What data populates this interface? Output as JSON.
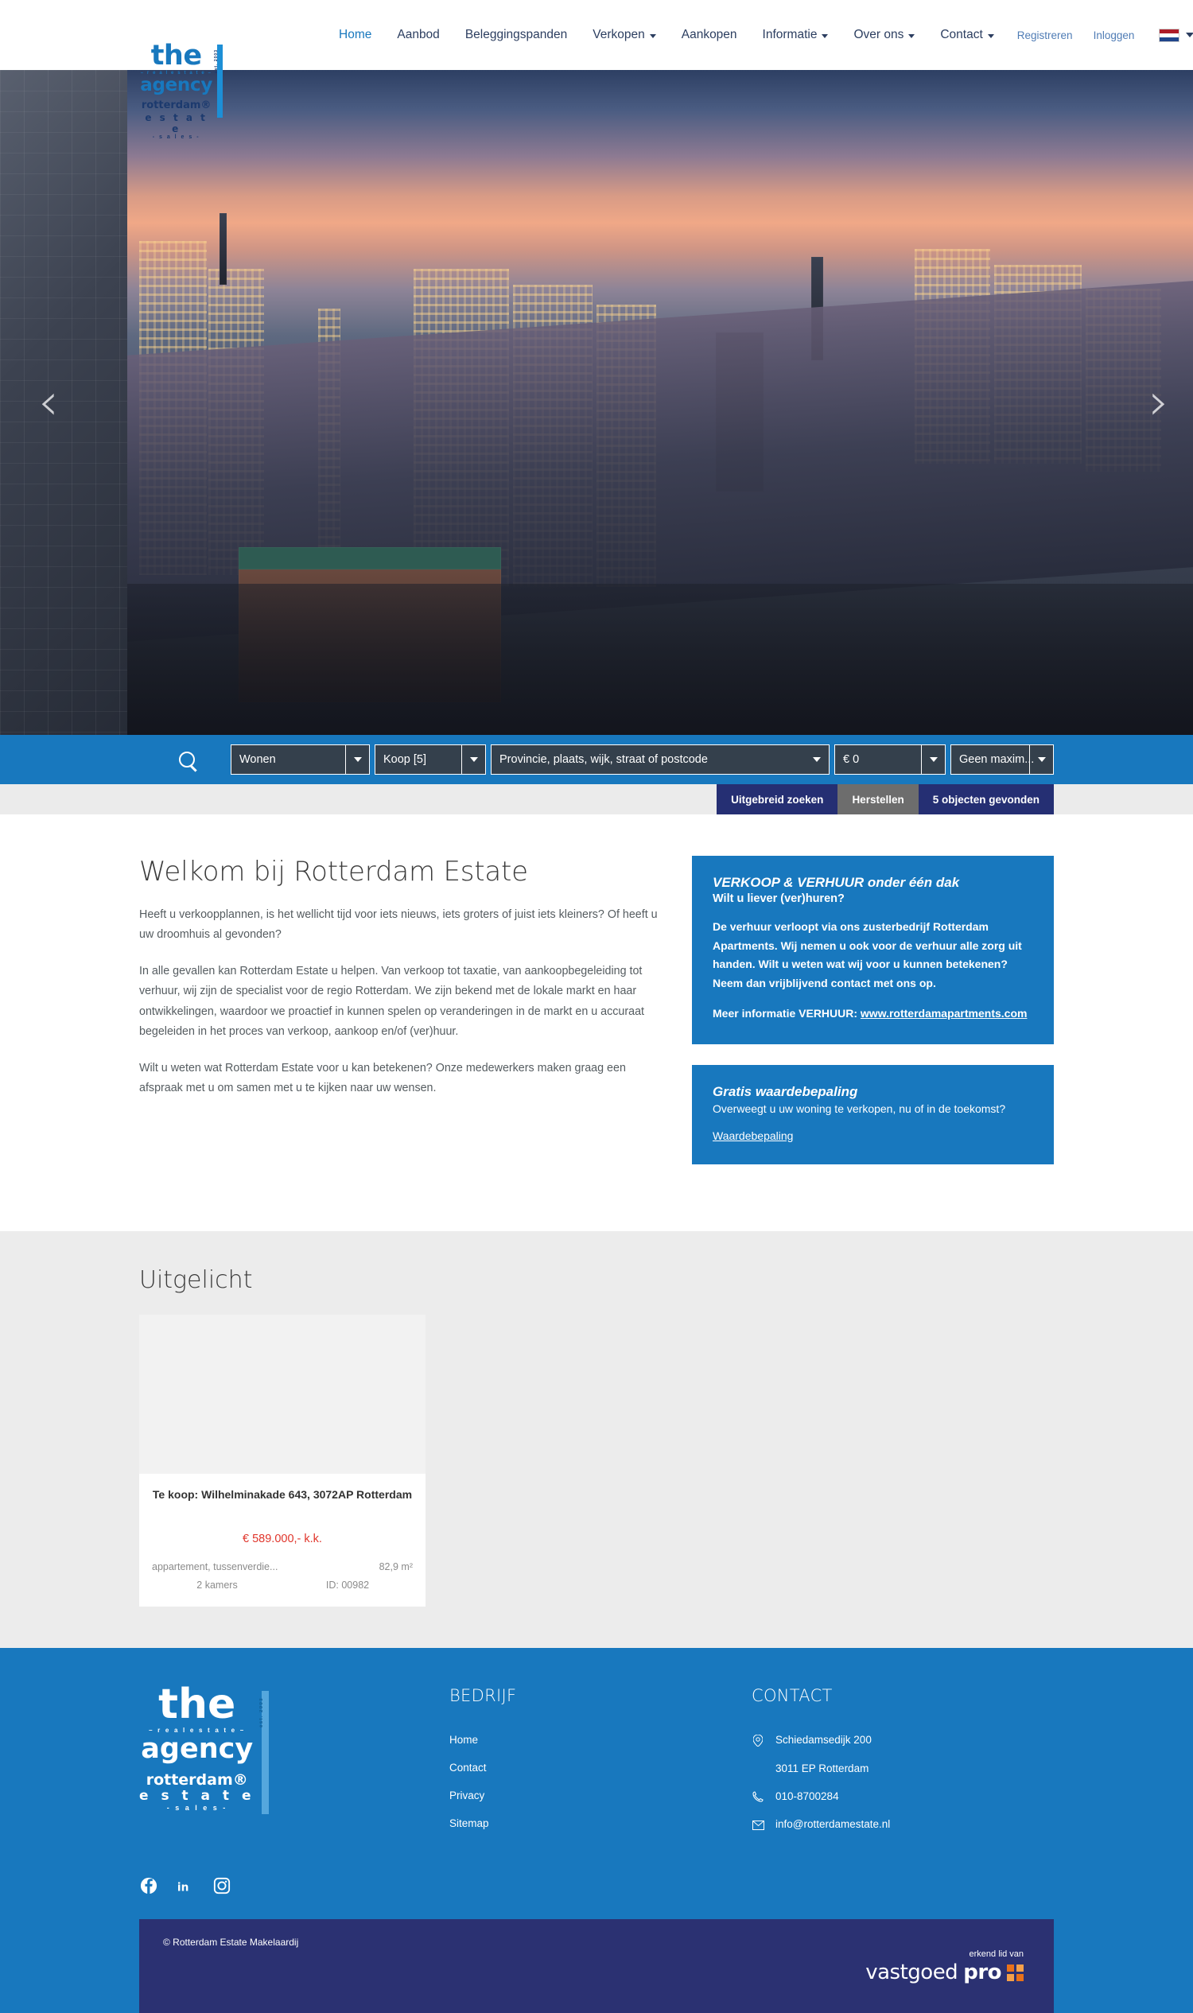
{
  "header": {
    "logo": {
      "the": "the",
      "tagline": "– r e a l   e s t a t e –",
      "agency": "agency",
      "rotterdam": "rotterdam®",
      "estate": "e s t a t e",
      "sales": "- s a l e s -",
      "est": "est. 2003"
    },
    "nav": [
      {
        "label": "Home",
        "active": true,
        "dropdown": false
      },
      {
        "label": "Aanbod",
        "active": false,
        "dropdown": false
      },
      {
        "label": "Beleggingspanden",
        "active": false,
        "dropdown": false
      },
      {
        "label": "Verkopen",
        "active": false,
        "dropdown": true
      },
      {
        "label": "Aankopen",
        "active": false,
        "dropdown": false
      },
      {
        "label": "Informatie",
        "active": false,
        "dropdown": true
      },
      {
        "label": "Over ons",
        "active": false,
        "dropdown": true
      },
      {
        "label": "Contact",
        "active": false,
        "dropdown": true
      }
    ],
    "auth": [
      {
        "label": "Registreren"
      },
      {
        "label": "Inloggen"
      }
    ],
    "language": "Nederlands"
  },
  "hero": {
    "prev_label": "‹",
    "next_label": "›",
    "alt": "Rotterdam skyline bij zonsondergang"
  },
  "search": {
    "icon": "search-icon",
    "type": {
      "value": "Wonen"
    },
    "offer": {
      "value": "Koop [5]"
    },
    "location": {
      "placeholder": "Provincie, plaats, wijk, straat of postcode",
      "value": ""
    },
    "price_min": {
      "value": "€ 0"
    },
    "price_max": {
      "value": "Geen maxim..."
    },
    "buttons": {
      "advanced": "Uitgebreid zoeken",
      "reset": "Herstellen",
      "results": "5 objecten gevonden"
    }
  },
  "main": {
    "title": "Welkom bij Rotterdam Estate",
    "paragraphs": [
      "Heeft u verkoopplannen, is het wellicht tijd voor iets nieuws, iets groters of juist iets kleiners? Of heeft u uw droomhuis al gevonden?",
      "In alle gevallen kan Rotterdam Estate u helpen. Van verkoop tot taxatie, van aankoopbegeleiding tot verhuur, wij zijn de specialist voor de regio Rotterdam. We zijn bekend met de lokale markt en haar ontwikkelingen, waardoor we proactief in kunnen spelen op veranderingen in de markt en u accuraat begeleiden in het proces van verkoop, aankoop en/of (ver)huur.",
      "Wilt u weten wat Rotterdam Estate voor u kan betekenen? Onze medewerkers maken graag een afspraak met u om samen met u te kijken naar uw wensen."
    ],
    "info_box_1": {
      "title": "VERKOOP & VERHUUR onder één dak",
      "subtitle": "Wilt u liever (ver)huren?",
      "body": "De verhuur verloopt via ons zusterbedrijf Rotterdam Apartments. Wij nemen u ook voor de verhuur alle zorg uit handen. Wilt u weten wat wij voor u kunnen betekenen? Neem dan vrijblijvend contact met ons op.",
      "more_prefix": "Meer informatie VERHUUR: ",
      "more_link": "www.rotterdamapartments.com"
    },
    "info_box_2": {
      "title": "Gratis waardebepaling",
      "subtitle": "Overweegt u uw woning te verkopen, nu of in de toekomst?",
      "link": "Waardebepaling"
    }
  },
  "featured": {
    "title": "Uitgelicht",
    "cards": [
      {
        "title": "Te koop: Wilhelminakade 643, 3072AP Rotterdam",
        "price": "€ 589.000,- k.k.",
        "type": "appartement, tussenverdie...",
        "area": "82,9 m²",
        "rooms": "2 kamers",
        "id": "ID: 00982"
      }
    ]
  },
  "footer": {
    "logo": {
      "the": "the",
      "tagline": "– r e a l   e s t a t e –",
      "agency": "agency",
      "rotterdam": "rotterdam®",
      "estate": "e s t a t e",
      "sales": "- s a l e s -",
      "est": "est. 2003"
    },
    "company": {
      "heading": "BEDRIJF",
      "links": [
        "Home",
        "Contact",
        "Privacy",
        "Sitemap"
      ]
    },
    "contact": {
      "heading": "CONTACT",
      "address_line1": "Schiedamsedijk 200",
      "address_line2": "3011 EP  Rotterdam",
      "phone": "010-8700284",
      "email": "info@rotterdamestate.nl"
    },
    "socials": [
      "facebook-icon",
      "linkedin-icon",
      "instagram-icon"
    ],
    "copyright": "© Rotterdam Estate Makelaardij",
    "partner": {
      "prefix": "erkend lid van",
      "name_light": "vastgoed",
      "name_bold": "pro"
    }
  },
  "colors": {
    "brand_blue": "#1878be",
    "dark_navy": "#2b3172",
    "accent_red": "#e0352b",
    "grey_bg": "#ececec"
  }
}
